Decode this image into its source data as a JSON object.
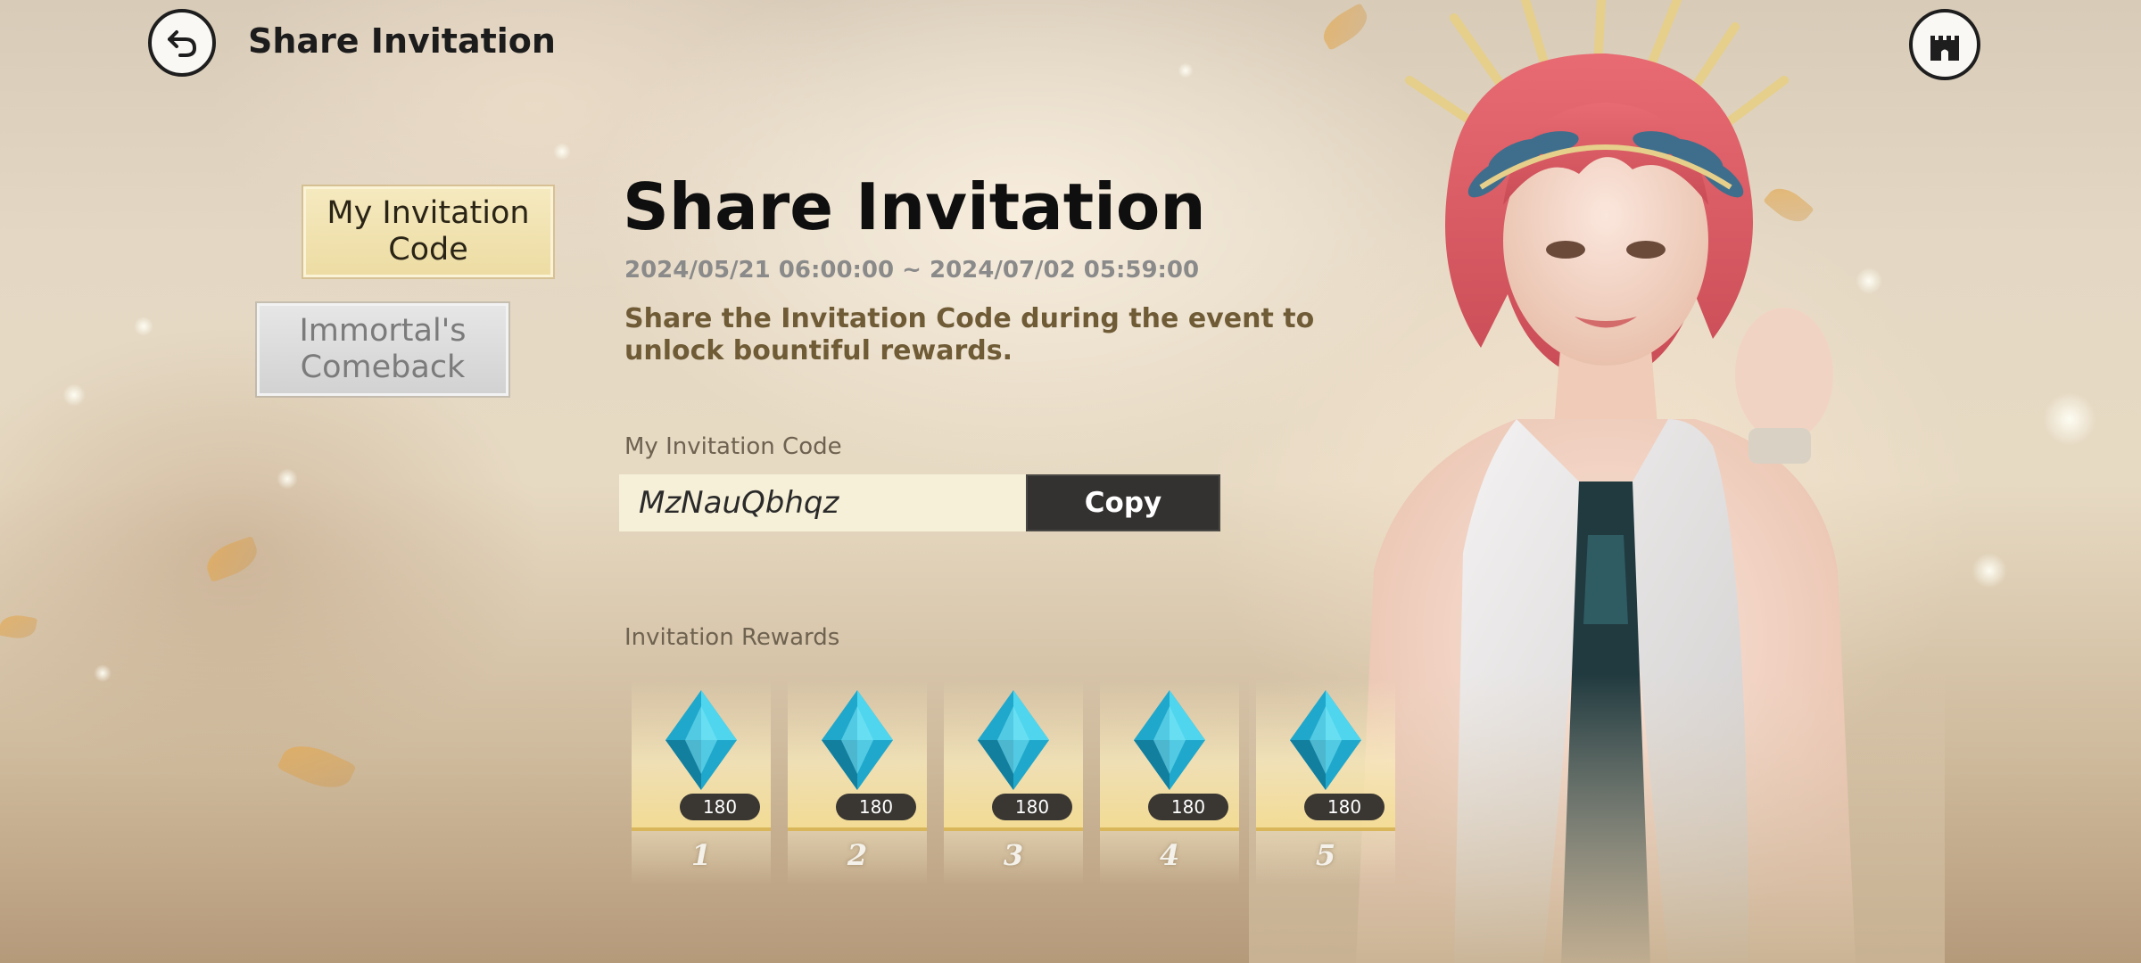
{
  "header": {
    "title": "Share Invitation",
    "back_icon": "back-arrow-icon",
    "right_icon": "castle-icon"
  },
  "tabs": [
    {
      "label": "My Invitation Code",
      "active": true
    },
    {
      "label": "Immortal's Comeback",
      "active": false
    }
  ],
  "event": {
    "title": "Share Invitation",
    "date_range": "2024/05/21 06:00:00 ~ 2024/07/02 05:59:00",
    "description": "Share the Invitation Code during the event to unlock bountiful rewards."
  },
  "invitation_code": {
    "label": "My Invitation Code",
    "value": "MzNauQbhqz",
    "copy_label": "Copy"
  },
  "rewards": {
    "label": "Invitation Rewards",
    "items": [
      {
        "index": "1",
        "quantity": "180",
        "icon": "blue-crystal-icon"
      },
      {
        "index": "2",
        "quantity": "180",
        "icon": "blue-crystal-icon"
      },
      {
        "index": "3",
        "quantity": "180",
        "icon": "blue-crystal-icon"
      },
      {
        "index": "4",
        "quantity": "180",
        "icon": "blue-crystal-icon"
      },
      {
        "index": "5",
        "quantity": "180",
        "icon": "blue-crystal-icon"
      }
    ]
  },
  "colors": {
    "active_tab": "#eddca3",
    "inactive_tab": "#d2d2d2",
    "copy_button": "#343230",
    "code_field": "#f6f0d8",
    "description_text": "#6f5b36",
    "crystal": "#1fb5d6"
  }
}
